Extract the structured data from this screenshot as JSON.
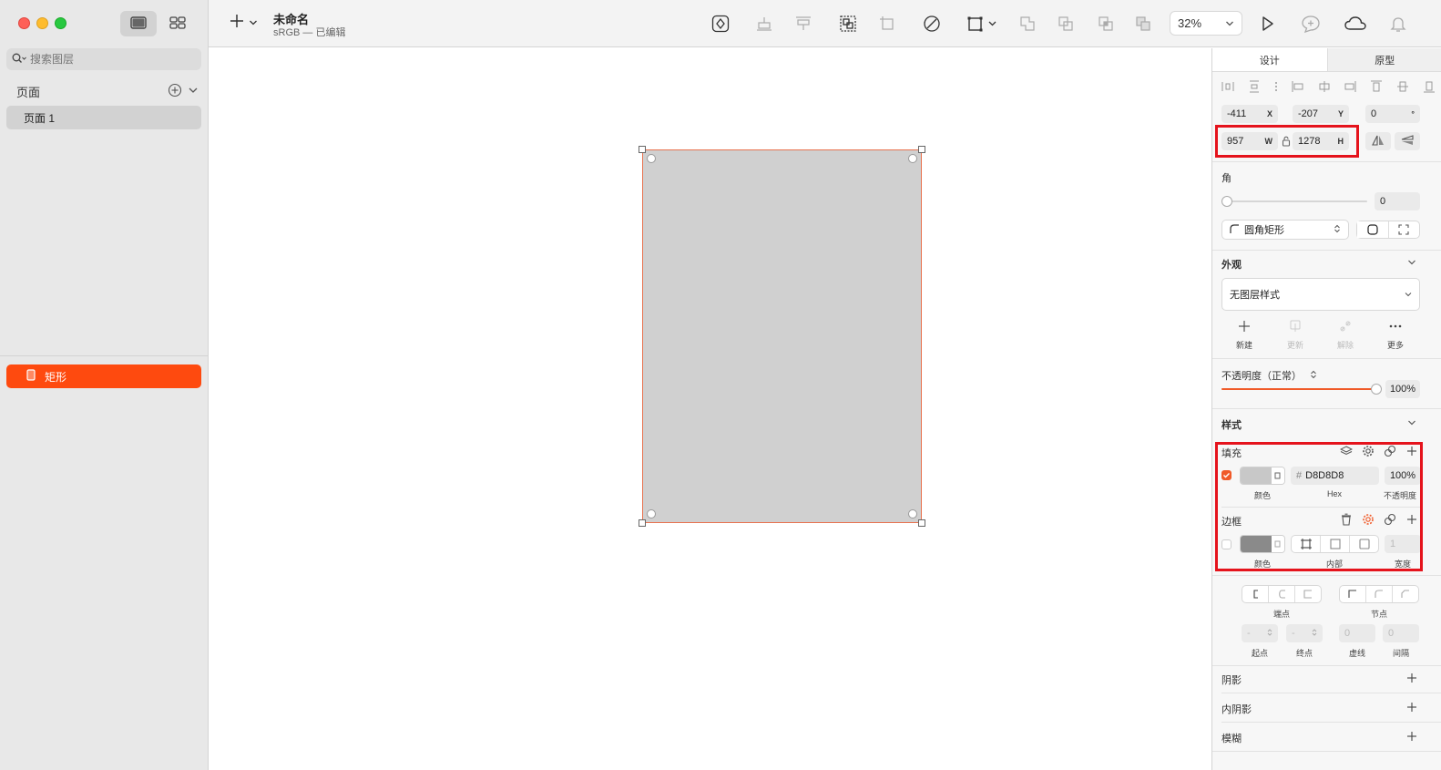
{
  "window": {
    "title": "未命名",
    "subtitle": "sRGB — 已编辑"
  },
  "sidebar": {
    "search_placeholder": "搜索图层",
    "pages_label": "页面",
    "pages": [
      {
        "label": "页面 1"
      }
    ],
    "layers": [
      {
        "label": "矩形",
        "color": "#fe4a0f"
      }
    ]
  },
  "toolbar": {
    "zoom": "32%"
  },
  "inspector": {
    "tabs": [
      {
        "label": "设计"
      },
      {
        "label": "原型"
      }
    ],
    "position": {
      "x": "-411",
      "x_label": "X",
      "y": "-207",
      "y_label": "Y",
      "rotation": "0",
      "rotation_label": "°"
    },
    "size": {
      "w": "957",
      "w_label": "W",
      "h": "1278",
      "h_label": "H"
    },
    "corner": {
      "label": "角",
      "value": "0",
      "style": "圆角矩形"
    },
    "appearance": {
      "label": "外观",
      "style": "无图层样式",
      "actions": [
        {
          "label": "新建"
        },
        {
          "label": "更新"
        },
        {
          "label": "解除"
        },
        {
          "label": "更多"
        }
      ]
    },
    "opacity": {
      "label": "不透明度（正常）",
      "value": "100%",
      "fraction": 1.0
    },
    "style_section": {
      "label": "样式"
    },
    "fill": {
      "label": "填充",
      "hex_prefix": "#",
      "hex": "D8D8D8",
      "opacity": "100%",
      "color_label": "颜色",
      "hex_label": "Hex",
      "opacity_label": "不透明度",
      "swatch": "#c8c8c8",
      "enabled": true
    },
    "border": {
      "label": "边框",
      "width": "1",
      "color_label": "颜色",
      "position_label": "内部",
      "width_label": "宽度",
      "swatch": "#8a8a8a",
      "enabled": false
    },
    "ends": {
      "endpoints_label": "端点",
      "joints_label": "节点",
      "start_label": "起点",
      "start": "-",
      "end_label": "终点",
      "end": "-",
      "dash_label": "虚线",
      "dash": "0",
      "gap_label": "间隔",
      "gap": "0"
    },
    "shadow": {
      "label": "阴影"
    },
    "inner_shadow": {
      "label": "内阴影"
    },
    "blur": {
      "label": "模糊"
    }
  }
}
